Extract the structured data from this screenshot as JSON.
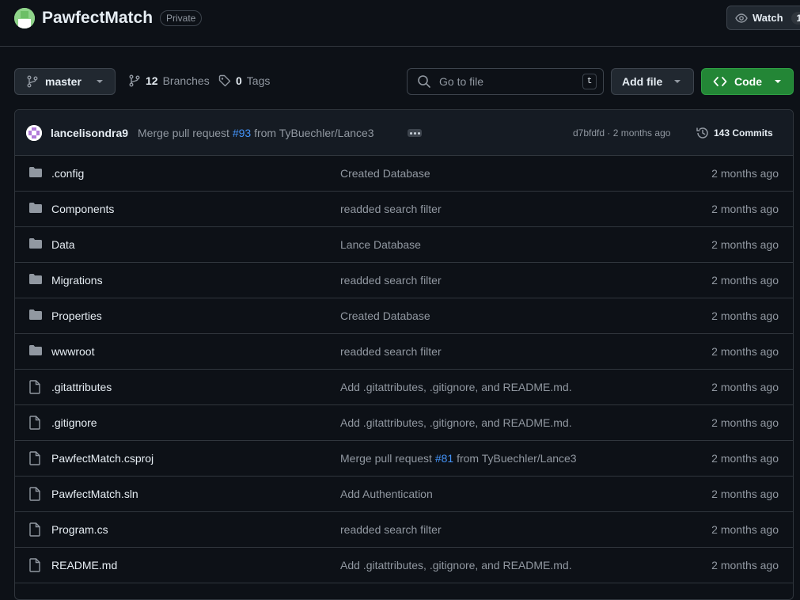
{
  "repo": {
    "name": "PawfectMatch",
    "visibility": "Private",
    "watch_label": "Watch",
    "watch_count": "1"
  },
  "toolbar": {
    "branch": "master",
    "branches_count": "12",
    "branches_label": "Branches",
    "tags_count": "0",
    "tags_label": "Tags",
    "search_placeholder": "Go to file",
    "search_shortcut": "t",
    "add_file_label": "Add file",
    "code_label": "Code"
  },
  "latest_commit": {
    "author": "lancelisondra9",
    "message_prefix": "Merge pull request",
    "pr_link": "#93",
    "message_suffix": "from TyBuechler/Lance3",
    "hash_time": "d7bfdfd · 2 months ago",
    "commits_label": "143 Commits"
  },
  "files": [
    {
      "type": "folder",
      "name": ".config",
      "message": "Created Database",
      "time": "2 months ago"
    },
    {
      "type": "folder",
      "name": "Components",
      "message": "readded search filter",
      "time": "2 months ago"
    },
    {
      "type": "folder",
      "name": "Data",
      "message": "Lance Database",
      "time": "2 months ago"
    },
    {
      "type": "folder",
      "name": "Migrations",
      "message": "readded search filter",
      "time": "2 months ago"
    },
    {
      "type": "folder",
      "name": "Properties",
      "message": "Created Database",
      "time": "2 months ago"
    },
    {
      "type": "folder",
      "name": "wwwroot",
      "message": "readded search filter",
      "time": "2 months ago"
    },
    {
      "type": "file",
      "name": ".gitattributes",
      "message": "Add .gitattributes, .gitignore, and README.md.",
      "time": "2 months ago"
    },
    {
      "type": "file",
      "name": ".gitignore",
      "message": "Add .gitattributes, .gitignore, and README.md.",
      "time": "2 months ago"
    },
    {
      "type": "file",
      "name": "PawfectMatch.csproj",
      "message": "Merge pull request",
      "message_link": "#81",
      "message_suffix": "from TyBuechler/Lance3",
      "time": "2 months ago"
    },
    {
      "type": "file",
      "name": "PawfectMatch.sln",
      "message": "Add Authentication",
      "time": "2 months ago"
    },
    {
      "type": "file",
      "name": "Program.cs",
      "message": "readded search filter",
      "time": "2 months ago"
    },
    {
      "type": "file",
      "name": "README.md",
      "message": "Add .gitattributes, .gitignore, and README.md.",
      "time": "2 months ago"
    }
  ],
  "colors": {
    "background": "#0d1117",
    "border": "#30363d",
    "text": "#e6edf3",
    "muted": "#9198a1",
    "link": "#4493f8",
    "green": "#238636"
  }
}
